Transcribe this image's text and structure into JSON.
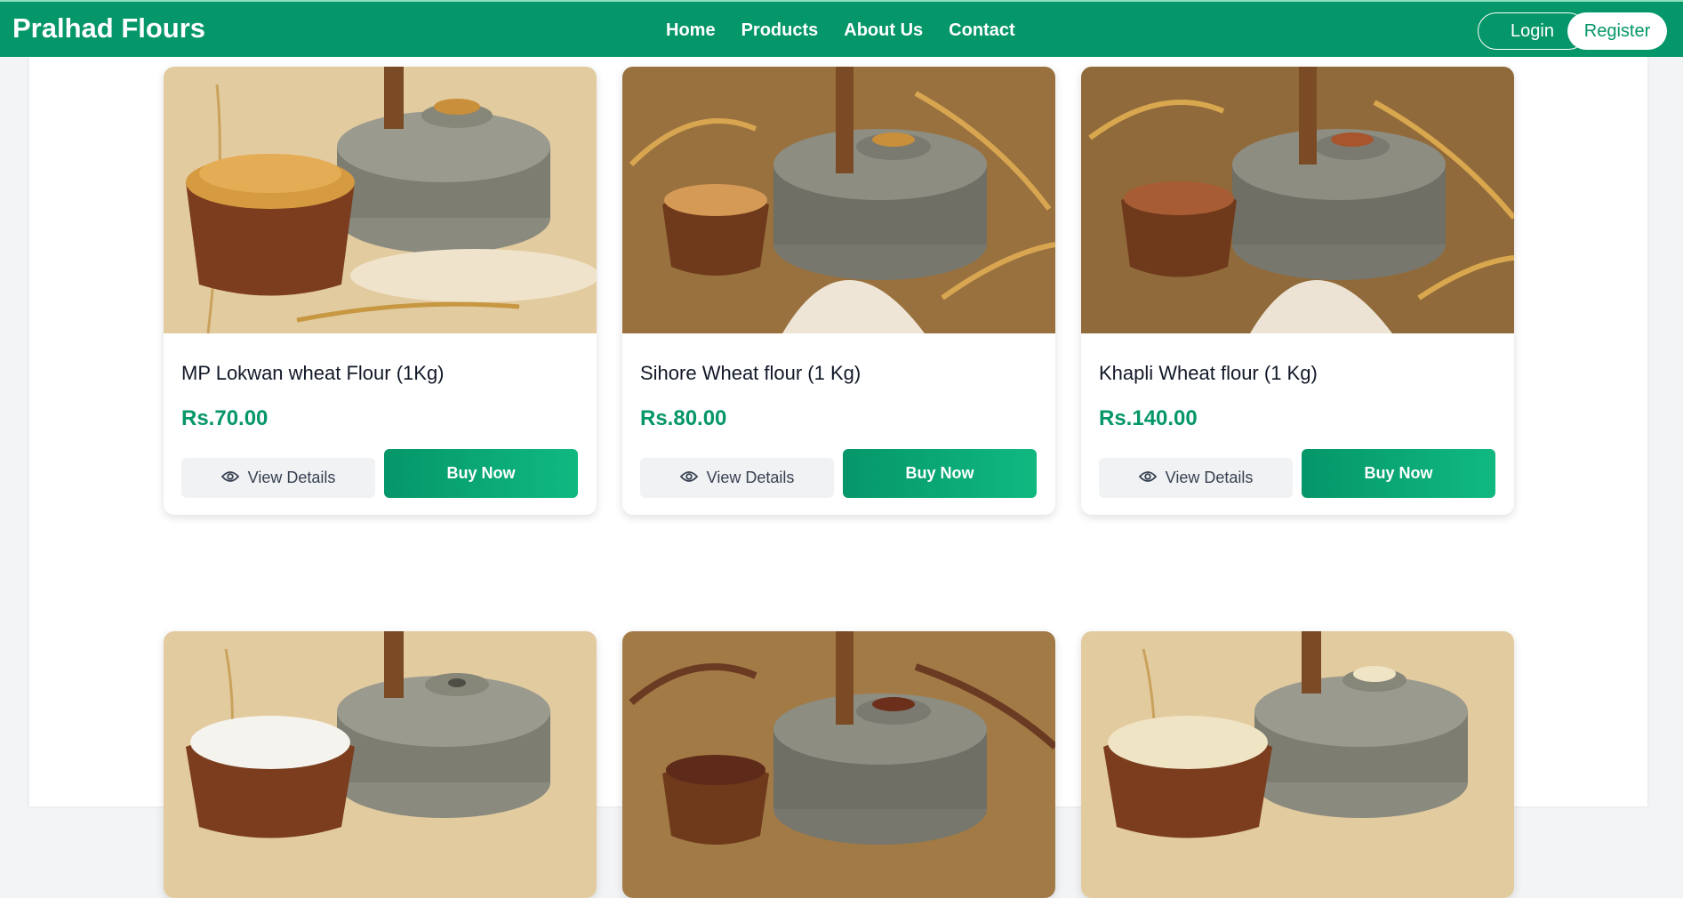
{
  "brand": "Pralhad Flours",
  "nav": {
    "home": "Home",
    "products": "Products",
    "about": "About Us",
    "contact": "Contact",
    "login": "Login",
    "register": "Register"
  },
  "colors": {
    "primary": "#059669",
    "accent": "#10b981",
    "price": "#059669",
    "view_button_bg": "#f1f2f4"
  },
  "products": [
    {
      "title": "MP Lokwan wheat Flour (1Kg)",
      "price": "Rs.70.00",
      "view_label": "View Details",
      "buy_label": "Buy Now",
      "grain": "golden wheat"
    },
    {
      "title": "Sihore Wheat flour (1 Kg)",
      "price": "Rs.80.00",
      "view_label": "View Details",
      "buy_label": "Buy Now",
      "grain": "amber wheat"
    },
    {
      "title": "Khapli Wheat flour (1 Kg)",
      "price": "Rs.140.00",
      "view_label": "View Details",
      "buy_label": "Buy Now",
      "grain": "red wheat"
    },
    {
      "title": "",
      "price": "",
      "view_label": "",
      "buy_label": "",
      "grain": "white rice"
    },
    {
      "title": "",
      "price": "",
      "view_label": "",
      "buy_label": "",
      "grain": "finger millet"
    },
    {
      "title": "",
      "price": "",
      "view_label": "",
      "buy_label": "",
      "grain": "white millet"
    }
  ],
  "icons": {
    "view": "eye-icon"
  }
}
